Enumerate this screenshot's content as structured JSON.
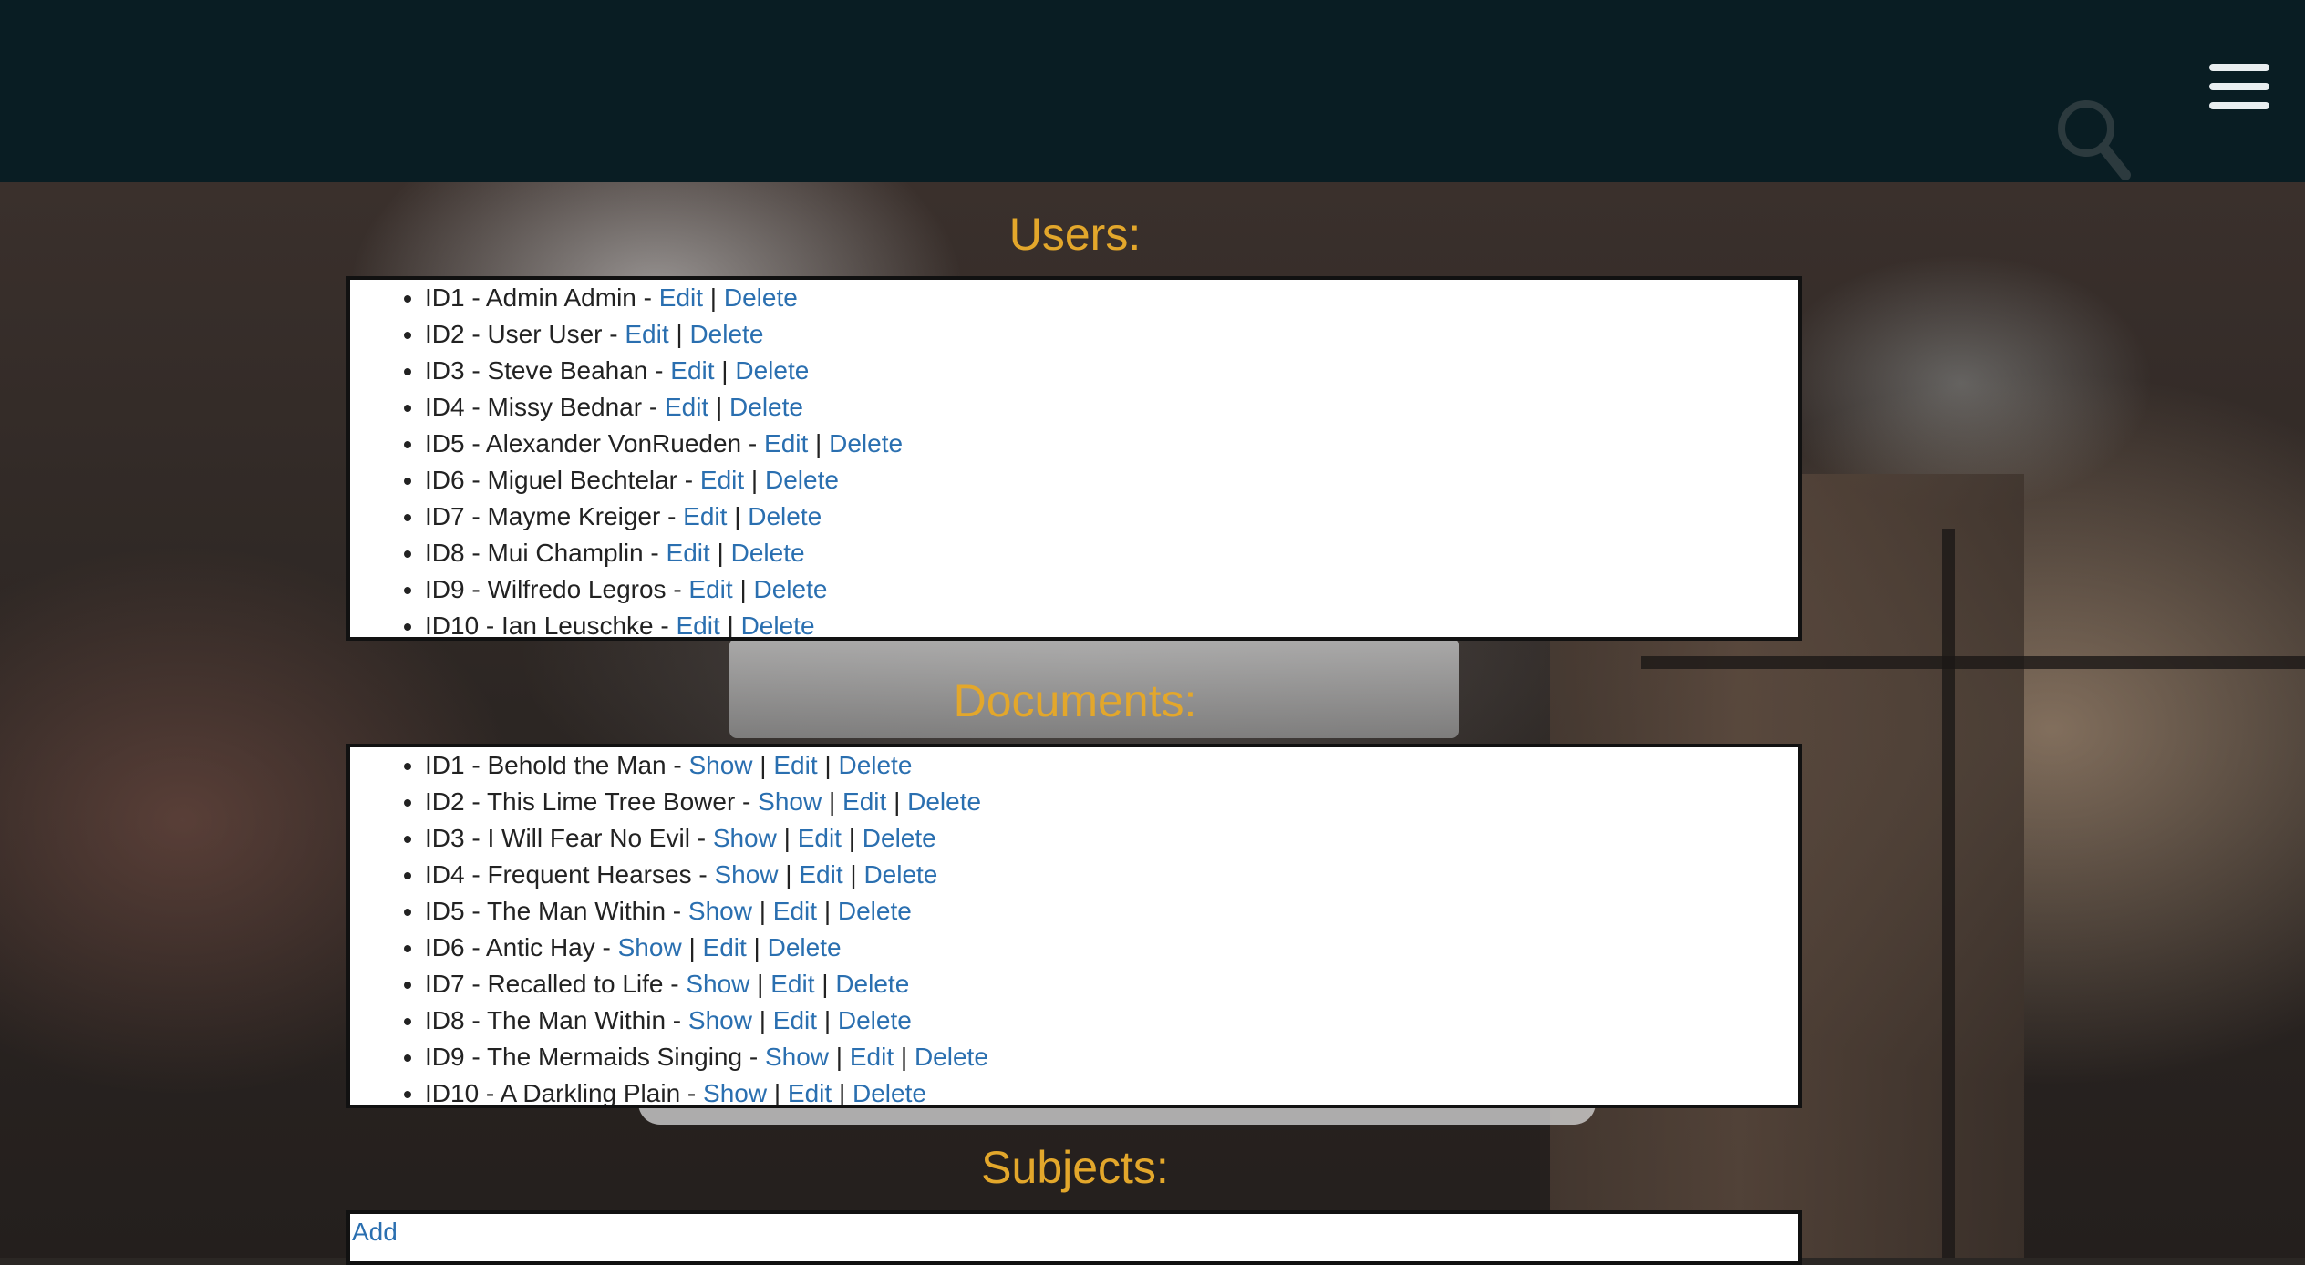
{
  "header": {
    "search_icon": "search-icon",
    "menu_icon": "hamburger-menu-icon"
  },
  "colors": {
    "header_bg": "#091d23",
    "title": "#e3a72b",
    "link": "#2a6fb0"
  },
  "users": {
    "title": "Users:",
    "items": [
      {
        "label": "ID1 - Admin Admin - ",
        "edit": "Edit",
        "sep": " | ",
        "delete": "Delete"
      },
      {
        "label": "ID2 - User User - ",
        "edit": "Edit",
        "sep": " | ",
        "delete": "Delete"
      },
      {
        "label": "ID3 - Steve Beahan - ",
        "edit": "Edit",
        "sep": " | ",
        "delete": "Delete"
      },
      {
        "label": "ID4 - Missy Bednar - ",
        "edit": "Edit",
        "sep": " | ",
        "delete": "Delete"
      },
      {
        "label": "ID5 - Alexander VonRueden - ",
        "edit": "Edit",
        "sep": " | ",
        "delete": "Delete"
      },
      {
        "label": "ID6 - Miguel Bechtelar - ",
        "edit": "Edit",
        "sep": " | ",
        "delete": "Delete"
      },
      {
        "label": "ID7 - Mayme Kreiger - ",
        "edit": "Edit",
        "sep": " | ",
        "delete": "Delete"
      },
      {
        "label": "ID8 - Mui Champlin - ",
        "edit": "Edit",
        "sep": " | ",
        "delete": "Delete"
      },
      {
        "label": "ID9 - Wilfredo Legros - ",
        "edit": "Edit",
        "sep": " | ",
        "delete": "Delete"
      },
      {
        "label": "ID10 - Ian Leuschke - ",
        "edit": "Edit",
        "sep": " | ",
        "delete": "Delete"
      }
    ]
  },
  "documents": {
    "title": "Documents:",
    "items": [
      {
        "label": "ID1 - Behold the Man - ",
        "show": "Show",
        "edit": "Edit",
        "delete": "Delete"
      },
      {
        "label": "ID2 - This Lime Tree Bower - ",
        "show": "Show",
        "edit": "Edit",
        "delete": "Delete"
      },
      {
        "label": "ID3 - I Will Fear No Evil - ",
        "show": "Show",
        "edit": "Edit",
        "delete": "Delete"
      },
      {
        "label": "ID4 - Frequent Hearses - ",
        "show": "Show",
        "edit": "Edit",
        "delete": "Delete"
      },
      {
        "label": "ID5 - The Man Within - ",
        "show": "Show",
        "edit": "Edit",
        "delete": "Delete"
      },
      {
        "label": "ID6 - Antic Hay - ",
        "show": "Show",
        "edit": "Edit",
        "delete": "Delete"
      },
      {
        "label": "ID7 - Recalled to Life - ",
        "show": "Show",
        "edit": "Edit",
        "delete": "Delete"
      },
      {
        "label": "ID8 - The Man Within - ",
        "show": "Show",
        "edit": "Edit",
        "delete": "Delete"
      },
      {
        "label": "ID9 - The Mermaids Singing - ",
        "show": "Show",
        "edit": "Edit",
        "delete": "Delete"
      },
      {
        "label": "ID10 - A Darkling Plain - ",
        "show": "Show",
        "edit": "Edit",
        "delete": "Delete"
      }
    ],
    "sep": " | "
  },
  "subjects": {
    "title": "Subjects:",
    "add_label": "Add"
  }
}
